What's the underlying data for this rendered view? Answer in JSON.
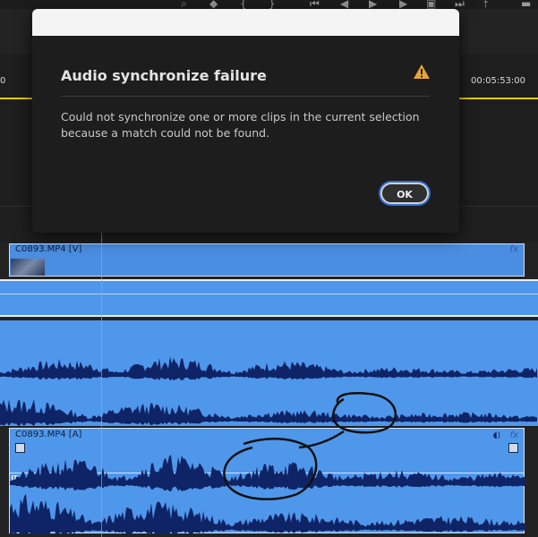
{
  "dialog": {
    "title": "Audio synchronize failure",
    "message": "Could not synchronize one or more clips in the current selection because a match could not be found.",
    "ok_label": "OK",
    "warning_color": "#e8a33a"
  },
  "ruler": {
    "left_label": "0",
    "right_label": "00:05:53:00"
  },
  "tracks": {
    "video_clip_label": "C0893.MP4 [V]",
    "audio_clip_label": "C0893.MP4 [A]",
    "fx_label": "fx",
    "channel_label": "L"
  },
  "colors": {
    "clip_blue": "#4f97ea",
    "waveform": "#0f2466",
    "playhead_line": "#e4d000",
    "annotation_ink": "#111111"
  }
}
